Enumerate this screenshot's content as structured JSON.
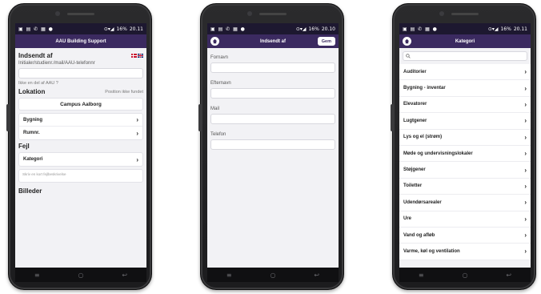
{
  "colors": {
    "app_bar": "#3b2a60",
    "status_bar": "#1d1830",
    "screen_bg": "#f2f2f5"
  },
  "status_bar": {
    "time1": "20.11",
    "time2": "20.10",
    "time3": "20.11",
    "battery": "16%"
  },
  "screen1": {
    "title": "AAU Building Support",
    "submitted_by": "Indsendt af",
    "initials_hint": "Initialer/studienr./mail/AAU-telefonnr",
    "not_aau": "Ikke en del af AAU ?",
    "location_label": "Lokation",
    "position_not_found": "Position ikke fundet",
    "campus": "Campus Aalborg",
    "building": "Bygning",
    "room": "Rumnr.",
    "error_label": "Fejl",
    "category": "Kategori",
    "description_placeholder": "Skriv en kort fejlbeskrivelse",
    "images_label": "Billeder"
  },
  "screen2": {
    "title": "Indsendt af",
    "save": "Gem",
    "fields": [
      "Fornavn",
      "Efternavn",
      "Mail",
      "Telefon"
    ]
  },
  "screen3": {
    "title": "Kategori",
    "search_placeholder": "",
    "categories": [
      "Auditorier",
      "Bygning - inventar",
      "Elevatorer",
      "Lugtgener",
      "Lys og el (strøm)",
      "Møde og undervisningslokaler",
      "Støjgener",
      "Toiletter",
      "Udendørsarealer",
      "Ure",
      "Vand og afløb",
      "Varme, køl og ventilation"
    ]
  },
  "icons": {
    "home": "home-icon",
    "chevron": "chevron-right-icon",
    "search": "search-icon"
  }
}
